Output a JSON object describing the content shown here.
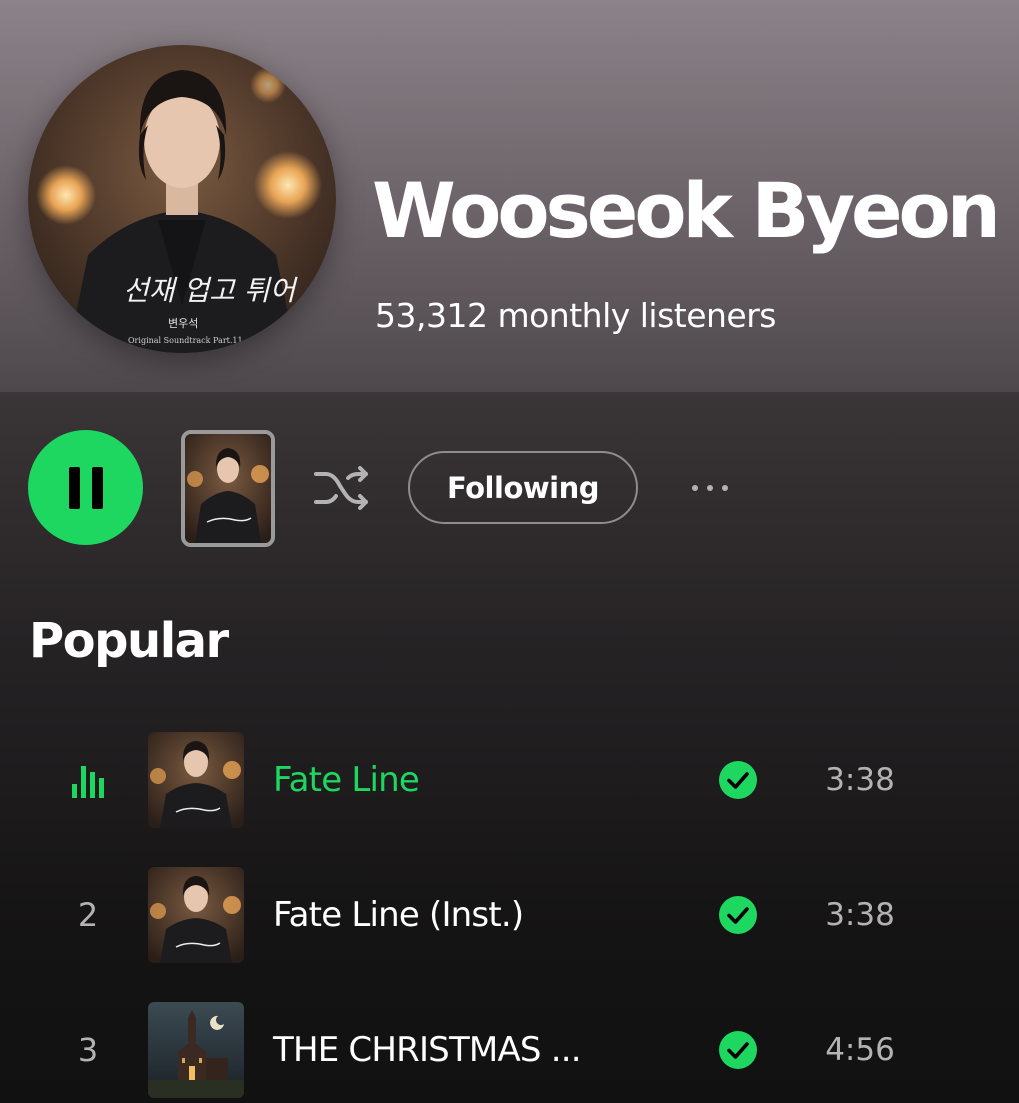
{
  "artist": {
    "name": "Wooseok Byeon",
    "monthly_listeners": "53,312 monthly listeners",
    "cover_title": "선재 업고 튀어",
    "cover_subtitle": "변우석",
    "cover_caption": "Original Soundtrack Part.11"
  },
  "controls": {
    "follow_label": "Following",
    "play_state": "paused-icon-shown",
    "play_icon": "pause-icon",
    "shuffle_icon": "shuffle-icon",
    "more_icon": "more-options-icon"
  },
  "popular": {
    "title": "Popular",
    "tracks": [
      {
        "index": "1",
        "title": "Fate Line",
        "duration": "3:38",
        "active": true,
        "saved": true
      },
      {
        "index": "2",
        "title": "Fate Line (Inst.)",
        "duration": "3:38",
        "active": false,
        "saved": true
      },
      {
        "index": "3",
        "title": "THE CHRISTMAS ...",
        "duration": "4:56",
        "active": false,
        "saved": true
      }
    ]
  },
  "colors": {
    "accent": "#1ed760",
    "background": "#121212",
    "header_top": "#8c8289",
    "secondary_text": "#b3b3b3"
  }
}
